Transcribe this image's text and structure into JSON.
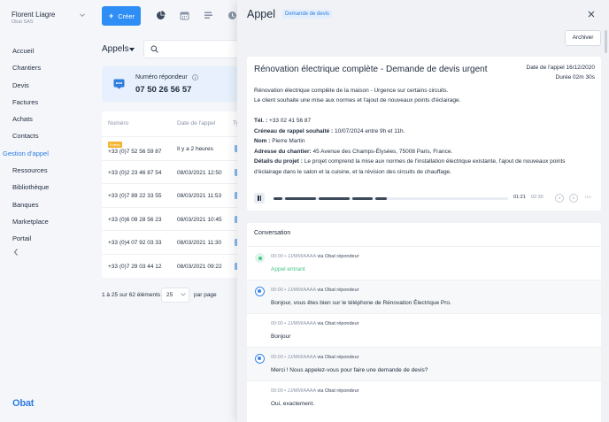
{
  "user": {
    "name": "Florent Liagre",
    "company": "Obat SAS"
  },
  "sidebar": {
    "items": [
      {
        "label": "Accueil"
      },
      {
        "label": "Chantiers"
      },
      {
        "label": "Devis"
      },
      {
        "label": "Factures"
      },
      {
        "label": "Achats"
      },
      {
        "label": "Contacts"
      },
      {
        "label": "Gestion d'appel",
        "active": true
      },
      {
        "label": "Ressources"
      },
      {
        "label": "Bibliothèque"
      },
      {
        "label": "Banques"
      },
      {
        "label": "Marketplace"
      },
      {
        "label": "Portail"
      }
    ],
    "logo": "Obat"
  },
  "toolbar": {
    "create_label": "Créer",
    "icons": [
      "pie-chart-icon",
      "calendar-icon",
      "list-icon",
      "clock-icon"
    ]
  },
  "list": {
    "title": "Appels",
    "responder": {
      "label": "Numéro répondeur",
      "number": "07 50 26 56 57"
    },
    "columns": [
      "Numéro",
      "Date de l'appel",
      "Ty"
    ],
    "rows": [
      {
        "tag": "Entrée",
        "number": "+33 (0)7 52 56 59 87",
        "date": "Il y a 2 heures"
      },
      {
        "number": "+33 (0)2 23 46 87 54",
        "date": "08/03/2021 12:50"
      },
      {
        "number": "+33 (0)7 89 22 33 55",
        "date": "08/03/2021 11:53"
      },
      {
        "number": "+33 (0)6 09 28 56 23",
        "date": "08/03/2021 10:45"
      },
      {
        "number": "+33 (0)4 07 92 03 33",
        "date": "08/03/2021 11:30"
      },
      {
        "number": "+33 (0)7 29 03 44 12",
        "date": "08/03/2021 09:22"
      }
    ],
    "pagination": {
      "summary": "1 à 25 sur 62 éléments",
      "per_page": "25",
      "per_page_label": "par page"
    }
  },
  "panel": {
    "title": "Appel",
    "badge": "Demande de devis",
    "archive_label": "Archiver",
    "detail": {
      "title": "Rénovation électrique complète - Demande de devis urgent",
      "date": "Date de l'appel 16/12/2020",
      "duration": "Durée 02m 30s",
      "summary_1": "Rénovation électrique complète de la maison - Urgence sur certains circuits.",
      "summary_2": "Le client souhaite une mise aux normes et l'ajout de nouveaux points d'éclairage.",
      "tel_label": "Tél. :",
      "tel_value": " +33 02 41 56 87",
      "slot_label": "Créneau de rappel souhaité :",
      "slot_value": " 10/07/2024 entre 9h et 11h.",
      "name_label": "Nom :",
      "name_value": " Pierre Martin",
      "address_label": "Adresse du chantier:",
      "address_value": " 45 Avenue des Champs-Élysées, 75008 Paris, France.",
      "project_label": "Détails du projet :",
      "project_value_1": " Le projet comprend la mise aux normes de l'installation électrique existante, l'ajout de nouveaux  points",
      "project_value_2": "d'éclairage dans le salon et la cuisine, et la révision des circuits de chauffage."
    },
    "player": {
      "current": "01:21",
      "total": "02:30",
      "progress": 0.54,
      "rate": "+1.0"
    },
    "conversation": {
      "title": "Conversation",
      "messages": [
        {
          "meta": "00:00 • JJ/MM/AAAA",
          "via": "via Obat répondeur",
          "text": "Appel entrant",
          "kind": "system"
        },
        {
          "meta": "00:00 • JJ/MM/AAAA",
          "via": "via Obat répondeur",
          "text": "Bonjour, vous êtes bien sur le téléphone de Rénovation Électrique Pro.",
          "kind": "bot"
        },
        {
          "meta": "00:00 • JJ/MM/AAAA",
          "via": "via Obat répondeur",
          "text": "Bonjour",
          "kind": "caller"
        },
        {
          "meta": "00:00 • JJ/MM/AAAA",
          "via": "via Obat répondeur",
          "text": "Merci ! Nous appelez-vous pour faire une demande de devis?",
          "kind": "bot"
        },
        {
          "meta": "00:00 • JJ/MM/AAAA",
          "via": "via Obat répondeur",
          "text": "Oui, exactement.",
          "kind": "caller"
        }
      ]
    }
  },
  "colors": {
    "accent": "#2f8ef5",
    "green": "#4cc38a",
    "tag": "#f4b433"
  }
}
